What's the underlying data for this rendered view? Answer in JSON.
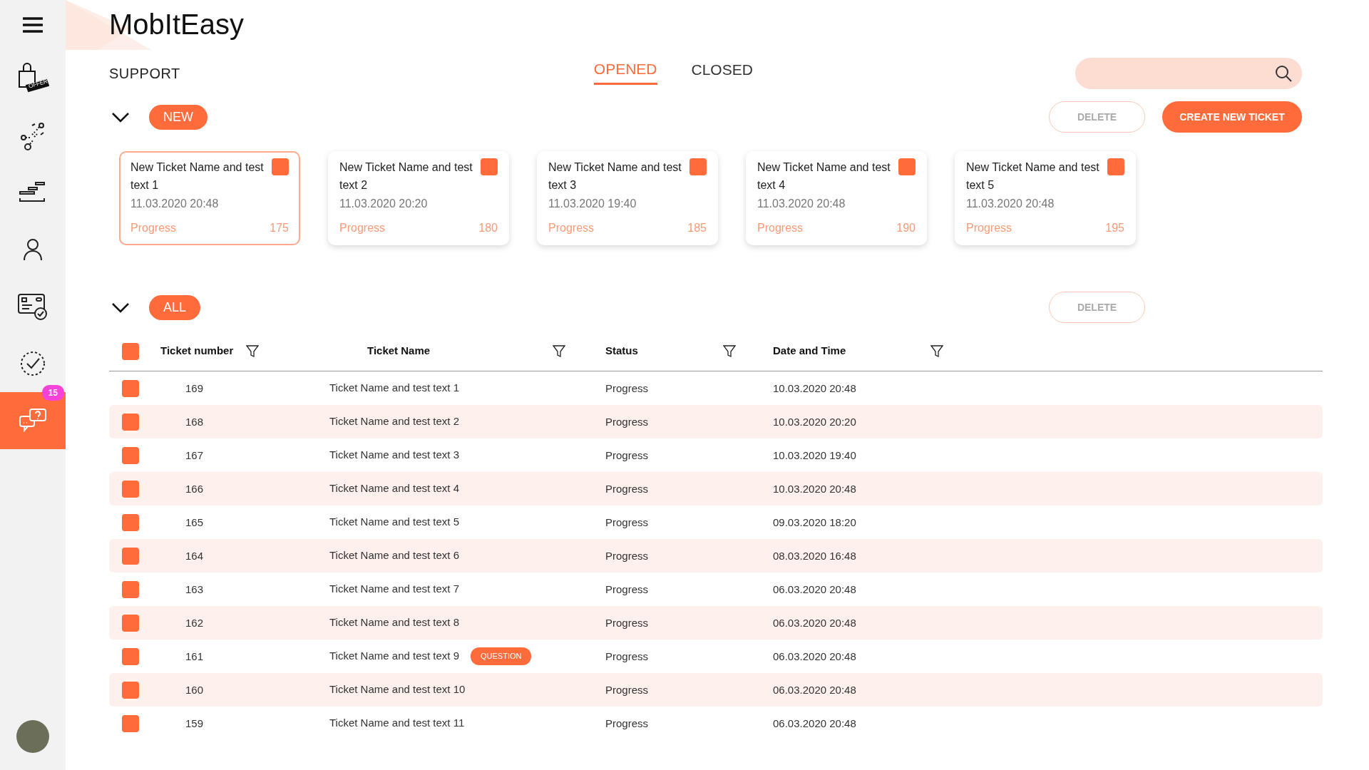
{
  "sidebar": {
    "items": [
      {
        "kind": "menu",
        "selected": false
      },
      {
        "kind": "offer",
        "tag": "OFFER",
        "selected": false
      },
      {
        "kind": "network",
        "selected": false
      },
      {
        "kind": "steps",
        "selected": false
      },
      {
        "kind": "person",
        "selected": false
      },
      {
        "kind": "card",
        "selected": false
      },
      {
        "kind": "check",
        "selected": false
      },
      {
        "kind": "support",
        "selected": true,
        "badge": "15"
      }
    ]
  },
  "app_title": "MobItEasy",
  "page_title": "SUPPORT",
  "tabs": [
    {
      "label": "OPENED",
      "selected": true
    },
    {
      "label": "CLOSED",
      "selected": false
    }
  ],
  "new_section": {
    "expanded": true,
    "label": "NEW",
    "buttons": [
      {
        "label": "DELETE",
        "kind": "outline"
      },
      {
        "label": "CREATE NEW TICKET",
        "kind": "primary"
      }
    ],
    "cards": [
      {
        "title": "New Ticket Name and test text 1",
        "date": "11.03.2020  20:48",
        "status": "Progress",
        "number": "175",
        "selected": true,
        "checked": true
      },
      {
        "title": "New Ticket Name and test text 2",
        "date": "11.03.2020  20:20",
        "status": "Progress",
        "number": "180",
        "selected": false,
        "checked": true
      },
      {
        "title": "New Ticket Name and test text 3",
        "date": "11.03.2020  19:40",
        "status": "Progress",
        "number": "185",
        "selected": false,
        "checked": true
      },
      {
        "title": "New Ticket Name and test text 4",
        "date": "11.03.2020  20:48",
        "status": "Progress",
        "number": "190",
        "selected": false,
        "checked": true
      },
      {
        "title": "New Ticket Name and test text 5",
        "date": "11.03.2020  20:48",
        "status": "Progress",
        "number": "195",
        "selected": false,
        "checked": true
      }
    ]
  },
  "all_section": {
    "expanded": true,
    "label": "ALL",
    "buttons": [
      {
        "label": "DELETE",
        "kind": "outline"
      }
    ],
    "table": {
      "select_all_checked": true,
      "columns": [
        "Ticket number",
        "Ticket Name",
        "Status",
        "Date and Time"
      ],
      "rows": [
        {
          "number": "169",
          "name": "Ticket Name and test  text 1",
          "status": "Progress",
          "date": "10.03.2020  20:48",
          "checked": true
        },
        {
          "number": "168",
          "name": "Ticket Name and test  text 2",
          "status": "Progress",
          "date": "10.03.2020  20:20",
          "checked": true
        },
        {
          "number": "167",
          "name": "Ticket Name and test  text 3",
          "status": "Progress",
          "date": "10.03.2020  19:40",
          "checked": true
        },
        {
          "number": "166",
          "name": "Ticket Name and test  text 4",
          "status": "Progress",
          "date": "10.03.2020  20:48",
          "checked": true
        },
        {
          "number": "165",
          "name": "Ticket Name and test  text 5",
          "status": "Progress",
          "date": "09.03.2020  18:20",
          "checked": true
        },
        {
          "number": "164",
          "name": "Ticket Name and test  text 6",
          "status": "Progress",
          "date": "08.03.2020  16:48",
          "checked": true
        },
        {
          "number": "163",
          "name": "Ticket Name and test  text 7",
          "status": "Progress",
          "date": "06.03.2020  20:48",
          "checked": true
        },
        {
          "number": "162",
          "name": "Ticket Name and test  text 8",
          "status": "Progress",
          "date": "06.03.2020  20:48",
          "checked": true
        },
        {
          "number": "161",
          "name": "Ticket Name and test  text 9",
          "tag": "QUESTION",
          "status": "Progress",
          "date": "06.03.2020  20:48",
          "checked": true
        },
        {
          "number": "160",
          "name": "Ticket Name and test  text 10",
          "status": "Progress",
          "date": "06.03.2020  20:48",
          "checked": true
        },
        {
          "number": "159",
          "name": "Ticket Name and test  text 11",
          "status": "Progress",
          "date": "06.03.2020  20:48",
          "checked": true
        }
      ]
    }
  }
}
